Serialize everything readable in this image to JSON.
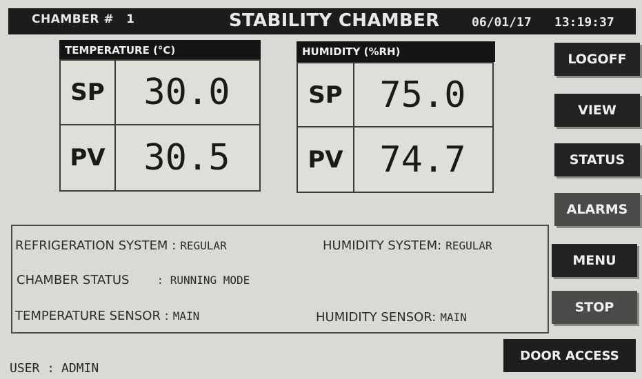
{
  "header": {
    "chamber_label": "CHAMBER #",
    "chamber_number": "1",
    "title": "STABILITY CHAMBER",
    "date": "06/01/17",
    "time": "13:19:37"
  },
  "temperature": {
    "header": "TEMPERATURE (°C)",
    "sp_label": "SP",
    "sp_value": "30.0",
    "pv_label": "PV",
    "pv_value": "30.5"
  },
  "humidity": {
    "header": "HUMIDITY (%RH)",
    "sp_label": "SP",
    "sp_value": "75.0",
    "pv_label": "PV",
    "pv_value": "74.7"
  },
  "status": {
    "refrigeration_label": "REFRIGERATION SYSTEM :",
    "refrigeration_value": "REGULAR",
    "humidity_system_label": "HUMIDITY SYSTEM:",
    "humidity_system_value": "REGULAR",
    "chamber_status_label": "CHAMBER STATUS",
    "chamber_status_value": ": RUNNING MODE",
    "temp_sensor_label": "TEMPERATURE SENSOR :",
    "temp_sensor_value": "MAIN",
    "humidity_sensor_label": "HUMIDITY SENSOR:",
    "humidity_sensor_value": "MAIN"
  },
  "buttons": {
    "logoff": "LOGOFF",
    "view": "VIEW",
    "status": "STATUS",
    "alarms": "ALARMS",
    "menu": "MENU",
    "stop": "STOP",
    "door_access": "DOOR ACCESS"
  },
  "footer": {
    "user_label": "USER :",
    "user_value": "ADMIN"
  },
  "colors": {
    "screen_background": "#d9dad5",
    "bar_black": "#1c1c1c",
    "button_dark": "#222222",
    "button_grey": "#4a4c49",
    "text_light": "#f0f0f0"
  }
}
